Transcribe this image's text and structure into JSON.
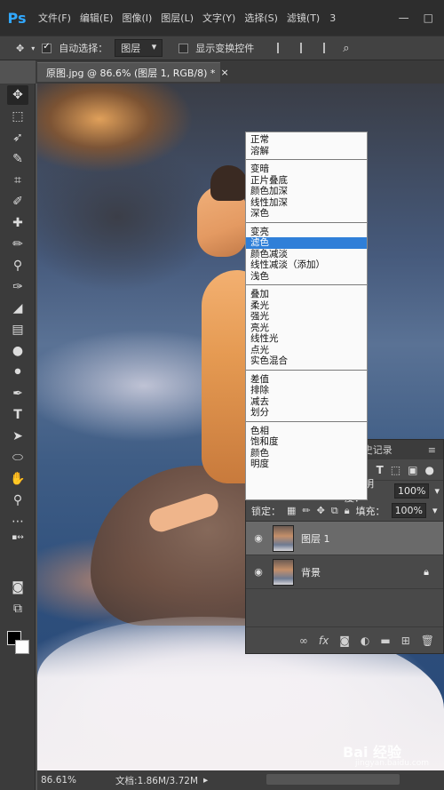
{
  "app": {
    "logo": "Ps"
  },
  "menubar": {
    "items": [
      "文件(F)",
      "编辑(E)",
      "图像(I)",
      "图层(L)",
      "文字(Y)",
      "选择(S)",
      "滤镜(T)"
    ],
    "overflow": "3",
    "window_controls": [
      "—",
      "□"
    ]
  },
  "options_bar": {
    "auto_select_label": "自动选择：",
    "auto_select_value": "图层",
    "show_transform_label": "显示变换控件"
  },
  "document_tab": {
    "title": "原图.jpg @ 86.6% (图层 1, RGB/8) *",
    "close": "×"
  },
  "blend_menu": {
    "groups": [
      [
        "正常",
        "溶解"
      ],
      [
        "变暗",
        "正片叠底",
        "颜色加深",
        "线性加深",
        "深色"
      ],
      [
        "变亮",
        "滤色",
        "颜色减淡",
        "线性减淡（添加）",
        "浅色"
      ],
      [
        "叠加",
        "柔光",
        "强光",
        "亮光",
        "线性光",
        "点光",
        "实色混合"
      ],
      [
        "差值",
        "排除",
        "减去",
        "划分"
      ],
      [
        "色相",
        "饱和度",
        "颜色",
        "明度"
      ]
    ],
    "selected": "滤色"
  },
  "layers_panel": {
    "tab_label": "史记录",
    "blend_mode": "正常",
    "opacity_label": "不透明度：",
    "opacity_value": "100%",
    "lock_label": "锁定：",
    "fill_label": "填充：",
    "fill_value": "100%",
    "layers": [
      {
        "name": "图层 1",
        "selected": true,
        "locked": false
      },
      {
        "name": "背景",
        "selected": false,
        "locked": true
      }
    ],
    "footer_icons": [
      "link-icon",
      "fx-icon",
      "mask-icon",
      "adjustment-icon",
      "folder-icon",
      "new-layer-icon",
      "trash-icon"
    ]
  },
  "statusbar": {
    "zoom": "86.61%",
    "doc_info": "文档:1.86M/3.72M"
  },
  "watermark": {
    "text": "Bai 经验",
    "sub": "jingyan.baidu.com"
  },
  "colors": {
    "accent": "#31a8ff",
    "selection": "#2f7fd8"
  }
}
